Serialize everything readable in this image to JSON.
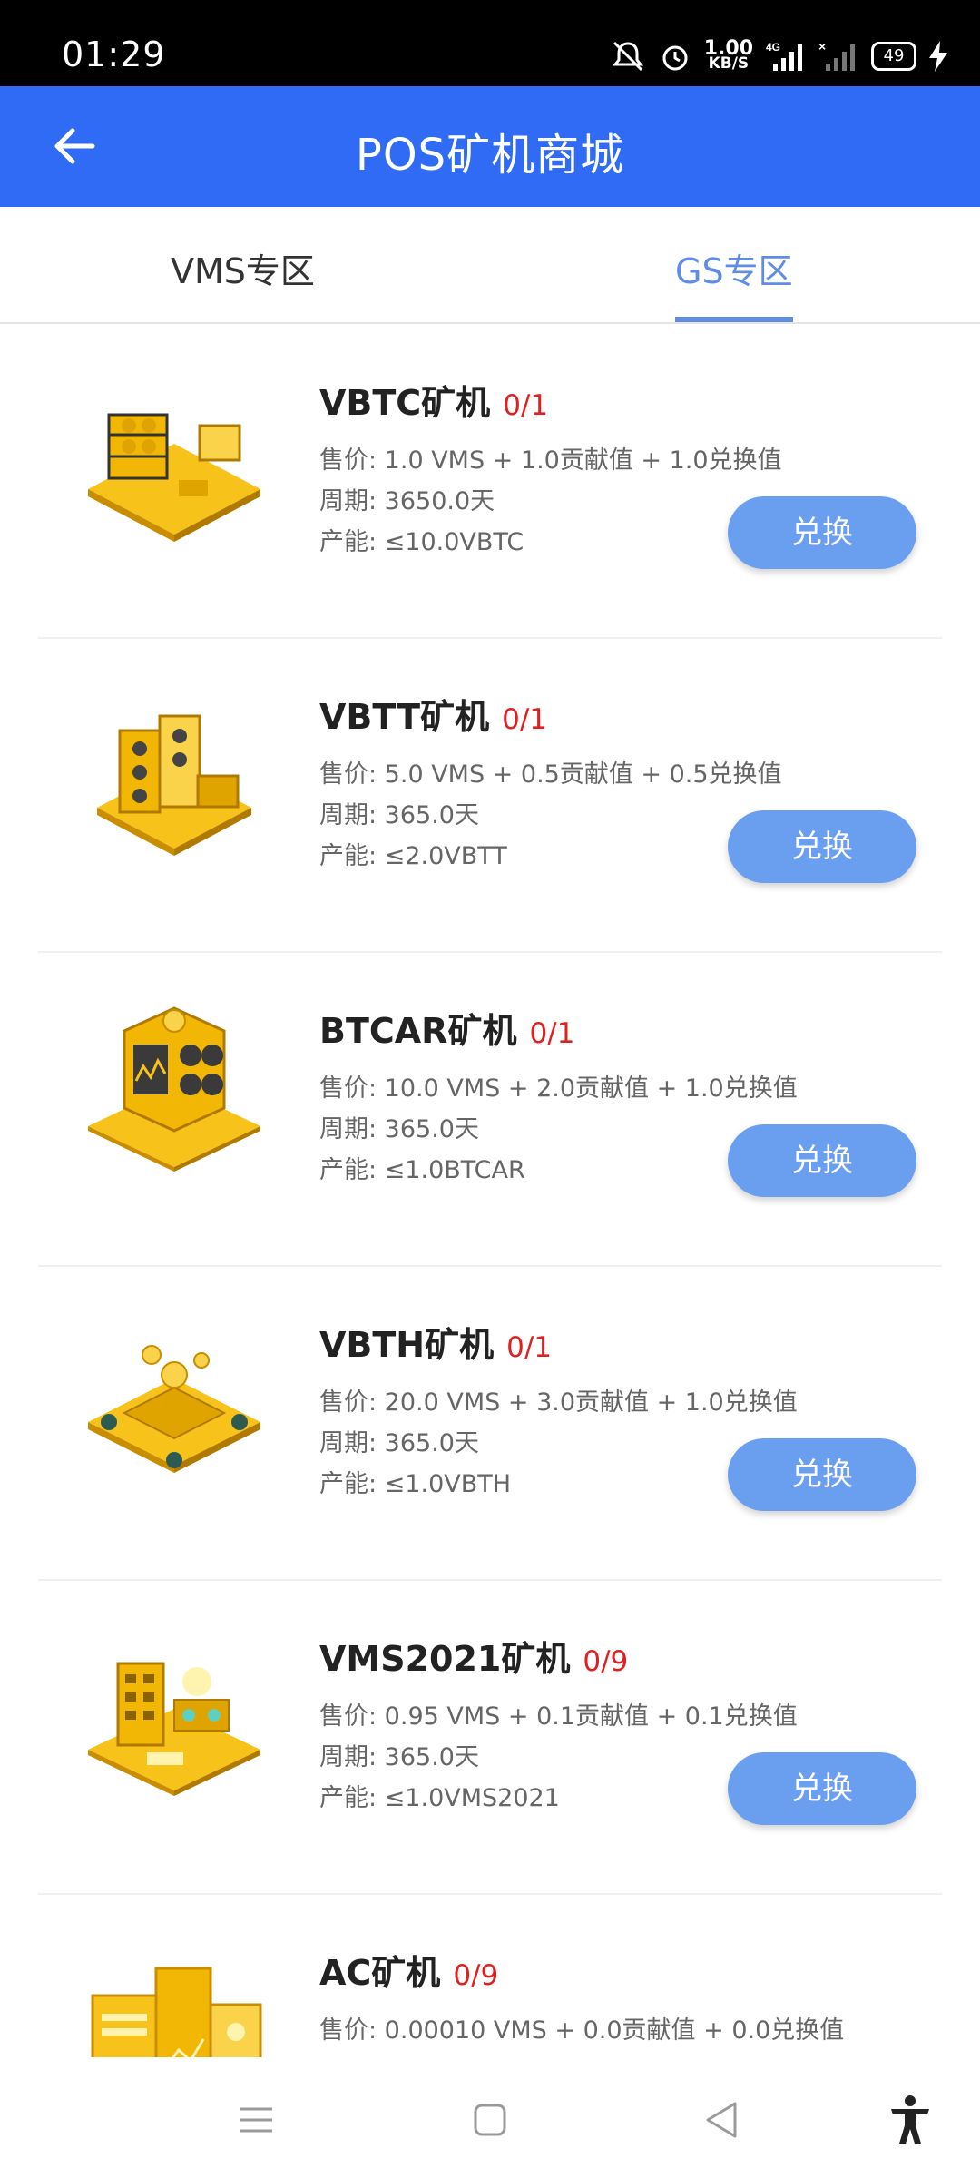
{
  "status_bar": {
    "time": "01:29",
    "speed_value": "1.00",
    "speed_unit": "KB/S",
    "network": "4G",
    "battery": "49"
  },
  "header": {
    "title": "POS矿机商城"
  },
  "tabs": [
    {
      "label": "VMS专区"
    },
    {
      "label": "GS专区"
    }
  ],
  "products": [
    {
      "name": "VBTC矿机",
      "count": "0/1",
      "price": "售价: 1.0 VMS + 1.0贡献值 + 1.0兑换值",
      "period": "周期: 3650.0天",
      "capacity": "产能: ≤10.0VBTC",
      "button": "兑换"
    },
    {
      "name": "VBTT矿机",
      "count": "0/1",
      "price": "售价: 5.0 VMS + 0.5贡献值 + 0.5兑换值",
      "period": "周期: 365.0天",
      "capacity": "产能: ≤2.0VBTT",
      "button": "兑换"
    },
    {
      "name": "BTCAR矿机",
      "count": "0/1",
      "price": "售价: 10.0 VMS + 2.0贡献值 + 1.0兑换值",
      "period": "周期: 365.0天",
      "capacity": "产能: ≤1.0BTCAR",
      "button": "兑换"
    },
    {
      "name": "VBTH矿机",
      "count": "0/1",
      "price": "售价: 20.0 VMS + 3.0贡献值 + 1.0兑换值",
      "period": "周期: 365.0天",
      "capacity": "产能: ≤1.0VBTH",
      "button": "兑换"
    },
    {
      "name": "VMS2021矿机",
      "count": "0/9",
      "price": "售价: 0.95 VMS + 0.1贡献值 + 0.1兑换值",
      "period": "周期: 365.0天",
      "capacity": "产能: ≤1.0VMS2021",
      "button": "兑换"
    },
    {
      "name": "AC矿机",
      "count": "0/9",
      "price": "售价: 0.00010 VMS + 0.0贡献值 + 0.0兑换值",
      "period": "",
      "capacity": "",
      "button": ""
    }
  ],
  "colors": {
    "primary": "#2f6bf5",
    "tab_active": "#5f8de6",
    "button": "#6a9ff0",
    "count": "#e02020",
    "mining_gold": "#f2b705"
  },
  "icons": {
    "back": "arrow-left-icon",
    "menu": "menu-icon",
    "home": "square-home-icon",
    "nav_back": "triangle-back-icon",
    "accessibility": "accessibility-icon"
  }
}
